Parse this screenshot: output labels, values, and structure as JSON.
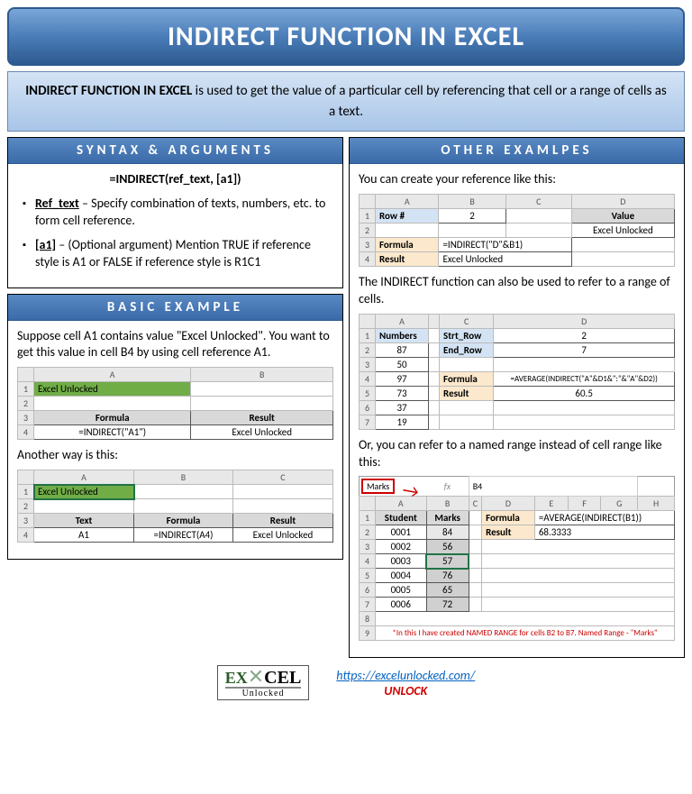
{
  "title": "INDIRECT FUNCTION IN EXCEL",
  "subtitle_bold": "INDIRECT FUNCTION IN EXCEL",
  "subtitle_rest": " is used to get the value of a particular cell by referencing that cell or a range of cells as a text.",
  "syntax": {
    "header": "SYNTAX & ARGUMENTS",
    "formula": "=INDIRECT(ref_text, [a1])",
    "arg1_name": "Ref_text",
    "arg1_desc": " – Specify combination of texts, numbers, etc. to form cell reference.",
    "arg2_name": "[a1]",
    "arg2_desc": " – (Optional argument) Mention TRUE if reference style is A1 or FALSE if reference style is R1C1"
  },
  "basic": {
    "header": "BASIC EXAMPLE",
    "intro": "Suppose cell A1 contains value \"Excel Unlocked\". You want to get this value in cell B4 by using cell reference A1.",
    "tbl1": {
      "a1": "Excel Unlocked",
      "h_formula": "Formula",
      "h_result": "Result",
      "formula": "=INDIRECT(\"A1\")",
      "result": "Excel Unlocked"
    },
    "another": "Another way is this:",
    "tbl2": {
      "a1": "Excel Unlocked",
      "h_text": "Text",
      "h_formula": "Formula",
      "h_result": "Result",
      "text": "A1",
      "formula": "=INDIRECT(A4)",
      "result": "Excel Unlocked"
    }
  },
  "other": {
    "header": "OTHER EXAMLPES",
    "p1": "You can create your reference like this:",
    "tbl1": {
      "row_lbl": "Row #",
      "rownum": "2",
      "value_lbl": "Value",
      "value": "Excel Unlocked",
      "formula_lbl": "Formula",
      "formula": "=INDIRECT(\"D\"&B1)",
      "result_lbl": "Result",
      "result": "Excel Unlocked"
    },
    "p2": "The INDIRECT function can also be used to refer to a range of cells.",
    "tbl2": {
      "numbers_lbl": "Numbers",
      "nums": [
        "87",
        "50",
        "97",
        "73",
        "37",
        "19"
      ],
      "strt_lbl": "Strt_Row",
      "strt_val": "2",
      "end_lbl": "End_Row",
      "end_val": "7",
      "formula_lbl": "Formula",
      "formula": "=AVERAGE(INDIRECT(\"A\"&D1&\":\"&\"A\"&D2))",
      "result_lbl": "Result",
      "result": "60.5"
    },
    "p3": "Or, you can refer to a named range instead of cell range like this:",
    "tbl3": {
      "namebox": "Marks",
      "fx": "B4",
      "student_lbl": "Student",
      "marks_lbl": "Marks",
      "rows": [
        {
          "s": "0001",
          "m": "84"
        },
        {
          "s": "0002",
          "m": "56"
        },
        {
          "s": "0003",
          "m": "57"
        },
        {
          "s": "0004",
          "m": "76"
        },
        {
          "s": "0005",
          "m": "65"
        },
        {
          "s": "0006",
          "m": "72"
        }
      ],
      "formula_lbl": "Formula",
      "formula": "=AVERAGE(INDIRECT(B1))",
      "result_lbl": "Result",
      "result": "68.3333",
      "footnote": "*In this I have created NAMED RANGE for cells B2 to B7. Named Range - \"Marks\""
    }
  },
  "footer": {
    "url": "https://excelunlocked.com/",
    "unlock": "UNLOCK",
    "logo_top1": "EX",
    "logo_top2": "CEL",
    "logo_sub": "Unlocked"
  }
}
